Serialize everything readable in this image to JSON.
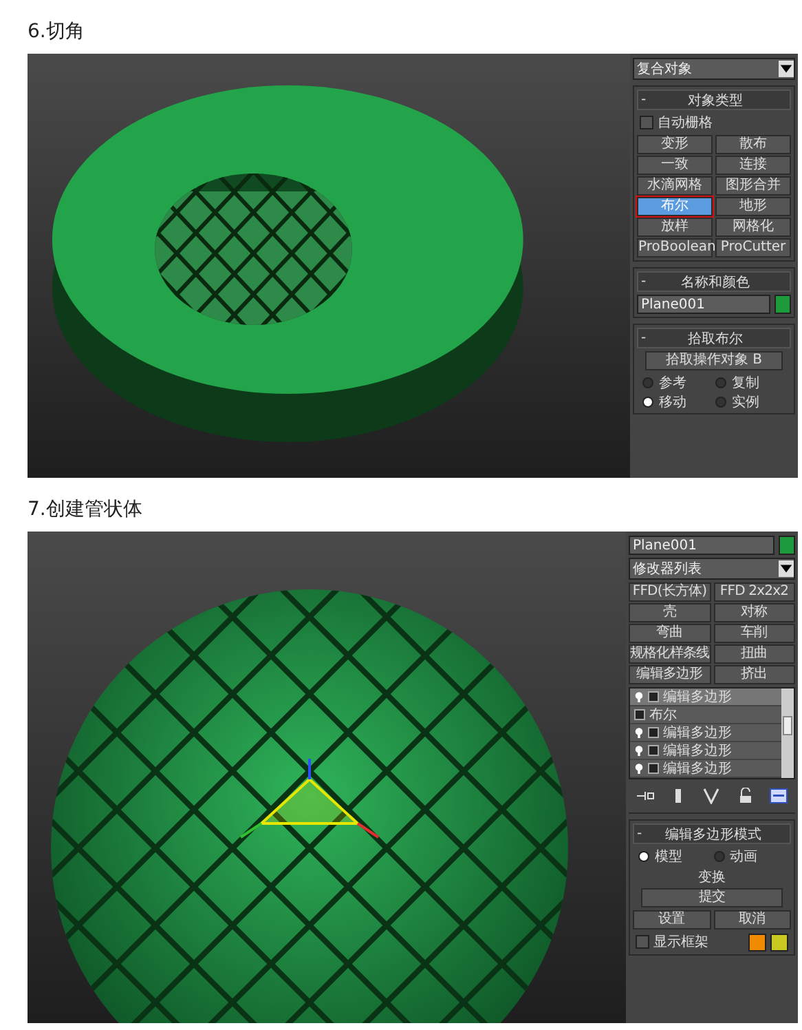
{
  "sections": [
    {
      "heading": "6.切角",
      "viewport": {
        "kind": "torus"
      },
      "panel": {
        "rollouts": [
          {
            "items": [
              {
                "kind": "dropdown",
                "value": "复合对象"
              }
            ]
          },
          {
            "title": "对象类型",
            "toggle": "-",
            "items": [
              {
                "kind": "checkbox",
                "label": "自动栅格",
                "checked": false
              },
              {
                "kind": "buttons",
                "buttons": [
                  {
                    "label": "变形",
                    "selected": false
                  },
                  {
                    "label": "散布",
                    "selected": false
                  },
                  {
                    "label": "一致",
                    "selected": false
                  },
                  {
                    "label": "连接",
                    "selected": false
                  },
                  {
                    "label": "水滴网格",
                    "selected": false
                  },
                  {
                    "label": "图形合并",
                    "selected": false
                  },
                  {
                    "label": "布尔",
                    "selected": true
                  },
                  {
                    "label": "地形",
                    "selected": false
                  },
                  {
                    "label": "放样",
                    "selected": false
                  },
                  {
                    "label": "网格化",
                    "selected": false
                  },
                  {
                    "label": "ProBoolean",
                    "selected": false
                  },
                  {
                    "label": "ProCutter",
                    "selected": false
                  }
                ]
              }
            ]
          },
          {
            "title": "名称和颜色",
            "toggle": "-",
            "items": [
              {
                "kind": "name-field",
                "value": "Plane001",
                "color": "#1c9a3c"
              }
            ]
          },
          {
            "title": "拾取布尔",
            "toggle": "-",
            "items": [
              {
                "kind": "button",
                "label": "拾取操作对象 B"
              },
              {
                "kind": "radios",
                "options": [
                  {
                    "label": "参考",
                    "selected": false
                  },
                  {
                    "label": "复制",
                    "selected": false
                  },
                  {
                    "label": "移动",
                    "selected": true
                  },
                  {
                    "label": "实例",
                    "selected": false
                  }
                ]
              }
            ]
          }
        ]
      }
    },
    {
      "heading": "7.创建管状体",
      "viewport": {
        "kind": "sphere"
      },
      "panel": {
        "rollouts": [
          {
            "items": [
              {
                "kind": "name-field",
                "value": "Plane001",
                "color": "#1c9a3c"
              },
              {
                "kind": "dropdown",
                "value": "修改器列表"
              },
              {
                "kind": "buttons",
                "buttons": [
                  {
                    "label": "FFD(长方体)",
                    "selected": false
                  },
                  {
                    "label": "FFD 2x2x2",
                    "selected": false
                  },
                  {
                    "label": "壳",
                    "selected": false
                  },
                  {
                    "label": "对称",
                    "selected": false
                  },
                  {
                    "label": "弯曲",
                    "selected": false
                  },
                  {
                    "label": "车削",
                    "selected": false
                  },
                  {
                    "label": "规格化样条线",
                    "selected": false
                  },
                  {
                    "label": "扭曲",
                    "selected": false
                  },
                  {
                    "label": "编辑多边形",
                    "selected": false
                  },
                  {
                    "label": "挤出",
                    "selected": false
                  }
                ]
              },
              {
                "kind": "stack",
                "rows": [
                  {
                    "kind": "modifier",
                    "label": "编辑多边形",
                    "selected": true
                  },
                  {
                    "kind": "object",
                    "label": "布尔",
                    "selected": false
                  },
                  {
                    "kind": "modifier",
                    "label": "编辑多边形",
                    "selected": false
                  },
                  {
                    "kind": "modifier",
                    "label": "编辑多边形",
                    "selected": false
                  },
                  {
                    "kind": "modifier",
                    "label": "编辑多边形",
                    "selected": false
                  }
                ]
              },
              {
                "kind": "toolbar"
              }
            ]
          },
          {
            "title": "编辑多边形模式",
            "toggle": "-",
            "items": [
              {
                "kind": "radios",
                "options": [
                  {
                    "label": "模型",
                    "selected": true
                  },
                  {
                    "label": "动画",
                    "selected": false
                  }
                ]
              },
              {
                "kind": "label",
                "text": "变换"
              },
              {
                "kind": "button",
                "label": "提交"
              },
              {
                "kind": "buttons",
                "buttons": [
                  {
                    "label": "设置",
                    "selected": false
                  },
                  {
                    "label": "取消",
                    "selected": false
                  }
                ]
              },
              {
                "kind": "checkbox",
                "label": "显示框架",
                "checked": false,
                "swatches": [
                  {
                    "color": "#f08a00"
                  },
                  {
                    "color": "#c8c820"
                  }
                ]
              }
            ]
          }
        ]
      }
    }
  ]
}
